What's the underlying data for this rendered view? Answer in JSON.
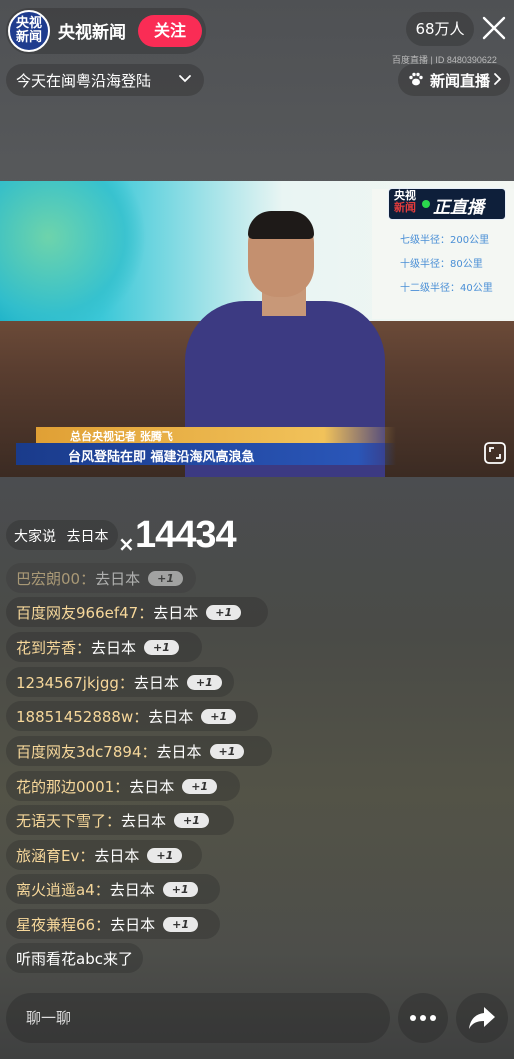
{
  "header": {
    "logo_line1": "央视",
    "logo_line2": "新闻",
    "channel_name": "央视新闻",
    "follow_label": "关注",
    "viewer_count": "68万人",
    "topic": "今天在闽粤沿海登陆",
    "source_line": "百度直播 | ID 8480390622",
    "news_live_label": "新闻直播"
  },
  "video": {
    "badge_logo_line1": "央视",
    "badge_logo_line2": "新闻",
    "badge_live_text": "正直播",
    "reporter_line": "总台央视记者 张腾飞",
    "headline": "台风登陆在即 福建沿海风高浪急",
    "screen_rows": [
      "七级半径：200公里",
      "十级半径：80公里",
      "十二级半径：40公里"
    ]
  },
  "highlight": {
    "prefix": "大家说",
    "phrase": "去日本",
    "multiplier": "×",
    "count": "14434"
  },
  "comments": [
    {
      "user": "巴宏朗00：",
      "msg": "去日本",
      "plus": "+1",
      "faded": true
    },
    {
      "user": "百度网友966ef47：",
      "msg": "去日本",
      "plus": "+1"
    },
    {
      "user": "花到芳香：",
      "msg": "去日本",
      "plus": "+1"
    },
    {
      "user": "1234567jkjgg：",
      "msg": "去日本",
      "plus": "+1"
    },
    {
      "user": "18851452888w：",
      "msg": "去日本",
      "plus": "+1"
    },
    {
      "user": "百度网友3dc7894：",
      "msg": "去日本",
      "plus": "+1"
    },
    {
      "user": "花的那边0001：",
      "msg": "去日本",
      "plus": "+1"
    },
    {
      "user": "无语天下雪了：",
      "msg": "去日本",
      "plus": "+1"
    },
    {
      "user": "旅涵育Ev：",
      "msg": "去日本",
      "plus": "+1"
    },
    {
      "user": "离火逍遥a4：",
      "msg": "去日本",
      "plus": "+1"
    },
    {
      "user": "星夜兼程66：",
      "msg": "去日本",
      "plus": "+1"
    }
  ],
  "join_notice": {
    "user": "听雨看花abc",
    "msg": " 来了"
  },
  "footer": {
    "chat_placeholder": "聊一聊"
  },
  "colors": {
    "follow_button": "#fa2c55",
    "username": "#f6d79a",
    "live_dot": "#2bd84d"
  }
}
